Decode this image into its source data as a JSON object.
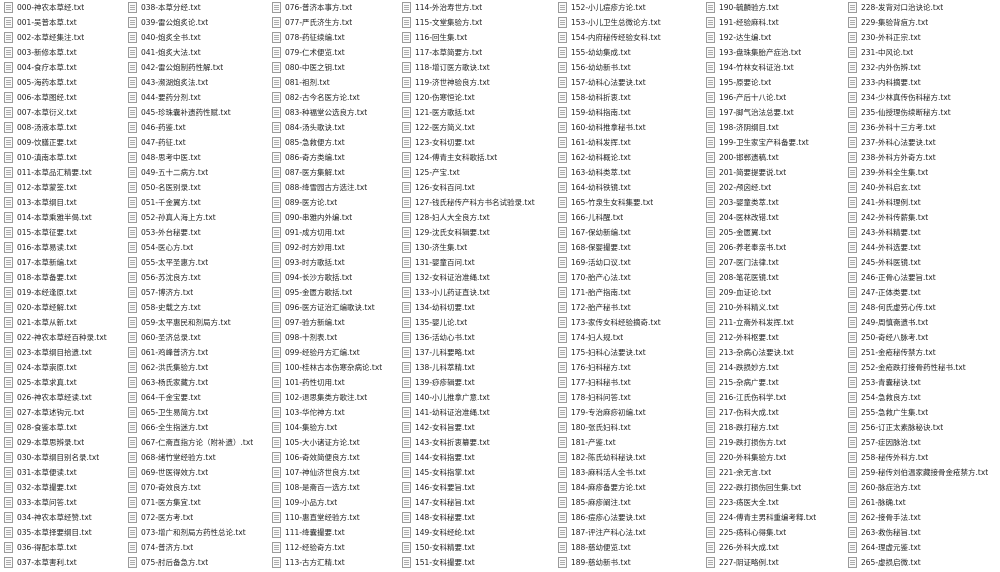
{
  "files": [
    "000-神农本草经.txt",
    "001-吴普本草.txt",
    "002-本草经集注.txt",
    "003-新修本草.txt",
    "004-食疗本草.txt",
    "005-海药本草.txt",
    "006-本草图经.txt",
    "007-本草衍义.txt",
    "008-汤液本草.txt",
    "009-饮膳正要.txt",
    "010-滇南本草.txt",
    "011-本草品汇精要.txt",
    "012-本草蒙筌.txt",
    "013-本草纲目.txt",
    "014-本草乘雅半偈.txt",
    "015-本草征要.txt",
    "016-本草易读.txt",
    "017-本草新编.txt",
    "018-本草备要.txt",
    "019-本经逢原.txt",
    "020-本草经解.txt",
    "021-本草从新.txt",
    "022-神农本草经百种录.txt",
    "023-本草纲目拾遗.txt",
    "024-本草崇原.txt",
    "025-本草求真.txt",
    "026-神农本草经读.txt",
    "027-本草述钩元.txt",
    "028-食鉴本草.txt",
    "029-本草思辨录.txt",
    "030-本草纲目别名录.txt",
    "031-本草便读.txt",
    "032-本草撮要.txt",
    "033-本草问答.txt",
    "034-神农本草经赞.txt",
    "035-本草择要纲目.txt",
    "036-得配本草.txt",
    "037-本草害利.txt",
    "038-本草分经.txt",
    "039-雷公炮炙论.txt",
    "040-炮炙全书.txt",
    "041-炮炙大法.txt",
    "042-雷公炮制药性解.txt",
    "043-濒湖炮炙法.txt",
    "044-要药分剂.txt",
    "045-珍珠囊补遗药性赋.txt",
    "046-药鉴.txt",
    "047-药征.txt",
    "048-思考中医.txt",
    "049-五十二病方.txt",
    "050-名医别录.txt",
    "051-千金翼方.txt",
    "052-孙真人海上方.txt",
    "053-外台秘要.txt",
    "054-医心方.txt",
    "055-太平圣惠方.txt",
    "056-苏沈良方.txt",
    "057-博济方.txt",
    "058-史载之方.txt",
    "059-太平惠民和剂局方.txt",
    "060-圣济总录.txt",
    "061-鸡峰普济方.txt",
    "062-洪氏集验方.txt",
    "063-杨氏家藏方.txt",
    "064-千金宝要.txt",
    "065-卫生易简方.txt",
    "066-全生指迷方.txt",
    "067-仁斋直指方论（附补遗）.txt",
    "068-绪竹堂经验方.txt",
    "069-世医得效方.txt",
    "070-奇效良方.txt",
    "071-医方集宜.txt",
    "072-医方考.txt",
    "073-增广和剂局方药性总论.txt",
    "074-普济方.txt",
    "075-肘后备急方.txt",
    "076-普济本事方.txt",
    "077-严氏济生方.txt",
    "078-药征续编.txt",
    "079-仁术便览.txt",
    "080-中医之钥.txt",
    "081-祖剂.txt",
    "082-古今名医方论.txt",
    "083-种福堂公选良方.txt",
    "084-汤头歌诀.txt",
    "085-急救便方.txt",
    "086-奇方类编.txt",
    "087-医方集解.txt",
    "088-绛雪园古方选注.txt",
    "089-医方论.txt",
    "090-串雅内外编.txt",
    "091-成方切用.txt",
    "092-时方妙用.txt",
    "093-时方歌括.txt",
    "094-长沙方歌括.txt",
    "095-金匮方歌括.txt",
    "096-医方证治汇编歌诀.txt",
    "097-验方新编.txt",
    "098-十剂表.txt",
    "099-经验丹方汇编.txt",
    "100-桂林古本伤寒杂病论.txt",
    "101-药性切用.txt",
    "102-退思集类方歌注.txt",
    "103-华佗神方.txt",
    "104-集验方.txt",
    "105-大小诸证方论.txt",
    "106-奇效简便良方.txt",
    "107-神仙济世良方.txt",
    "108-是斋百一选方.txt",
    "109-小品方.txt",
    "110-惠直堂经验方.txt",
    "111-绛囊撮要.txt",
    "112-经验奇方.txt",
    "113-古方汇精.txt",
    "114-外治寿世方.txt",
    "115-文堂集验方.txt",
    "116-回生集.txt",
    "117-本草简要方.txt",
    "118-增订医方歌诀.txt",
    "119-济世神验良方.txt",
    "120-伤寒恒论.txt",
    "121-医方歌括.txt",
    "122-医方简义.txt",
    "123-女科切要.txt",
    "124-傅青主女科歌括.txt",
    "125-产宝.txt",
    "126-女科百问.txt",
    "127-钱氏秘传产科方书名试验录.txt",
    "128-妇人大全良方.txt",
    "129-沈氏女科辑要.txt",
    "130-济生集.txt",
    "131-婴童百问.txt",
    "132-女科证治准绳.txt",
    "133-小儿药证直诀.txt",
    "134-幼科切要.txt",
    "135-婴儿论.txt",
    "136-活幼心书.txt",
    "137-儿科要略.txt",
    "138-儿科萃精.txt",
    "139-痧疹辑要.txt",
    "140-小儿推拿广意.txt",
    "141-幼科证治准绳.txt",
    "142-女科旨要.txt",
    "143-女科折衷纂要.txt",
    "144-女科指要.txt",
    "145-女科指掌.txt",
    "146-女科要旨.txt",
    "147-女科秘旨.txt",
    "148-女科秘要.txt",
    "149-女科经纶.txt",
    "150-女科精要.txt",
    "151-女科撮要.txt",
    "152-小儿痘疹方论.txt",
    "153-小儿卫生总微论方.txt",
    "154-内府秘传经验女科.txt",
    "155-幼幼集成.txt",
    "156-幼幼新书.txt",
    "157-幼科心法要诀.txt",
    "158-幼科折衷.txt",
    "159-幼科指南.txt",
    "160-幼科推拿秘书.txt",
    "161-幼科发挥.txt",
    "162-幼科概论.txt",
    "163-幼科类萃.txt",
    "164-幼科铁镜.txt",
    "165-竹泉生女科集要.txt",
    "166-儿科醒.txt",
    "167-保幼新编.txt",
    "168-保婴撮要.txt",
    "169-活幼口议.txt",
    "170-胎产心法.txt",
    "171-胎产指南.txt",
    "172-胎产秘书.txt",
    "173-家传女科经验摘奇.txt",
    "174-妇人规.txt",
    "175-妇科心法要诀.txt",
    "176-妇科秘方.txt",
    "177-妇科秘书.txt",
    "178-妇科问答.txt",
    "179-专治麻痧初编.txt",
    "180-张氏妇科.txt",
    "181-产鉴.txt",
    "182-陈氏幼科秘诀.txt",
    "183-麻科活人全书.txt",
    "184-麻疹备要方论.txt",
    "185-麻疹阐注.txt",
    "186-痘疹心法要诀.txt",
    "187-评注产科心法.txt",
    "188-慈幼便览.txt",
    "189-慈幼新书.txt",
    "190-毓麟验方.txt",
    "191-经验麻科.txt",
    "192-达生编.txt",
    "193-盘珠集胎产症治.txt",
    "194-竹林女科证治.txt",
    "195-原要论.txt",
    "196-产后十八论.txt",
    "197-脚气治法总要.txt",
    "198-济阴纲目.txt",
    "199-卫生家宝产科备要.txt",
    "200-邯郸遗稿.txt",
    "201-简要提要说.txt",
    "202-颅囟经.txt",
    "203-婴童类萃.txt",
    "204-医林改错.txt",
    "205-金匮翼.txt",
    "206-养老奉亲书.txt",
    "207-医门法律.txt",
    "208-笔花医镜.txt",
    "209-血证论.txt",
    "210-外科精义.txt",
    "211-立斋外科发挥.txt",
    "212-外科枢要.txt",
    "213-杂病心法要诀.txt",
    "214-跌损妙方.txt",
    "215-杂病广要.txt",
    "216-江氏伤科学.txt",
    "217-伤科大成.txt",
    "218-跌打秘方.txt",
    "219-跌打损伤方.txt",
    "220-外科集验方.txt",
    "221-余无言.txt",
    "222-跌打损伤回生集.txt",
    "223-疡医大全.txt",
    "224-傅青主男科重编考释.txt",
    "225-疡科心得集.txt",
    "226-外科大成.txt",
    "227-阴证略例.txt",
    "228-发背对口治诀论.txt",
    "229-集验背疽方.txt",
    "230-外科正宗.txt",
    "231-中风论.txt",
    "232-内外伤辨.txt",
    "233-内科摘要.txt",
    "234-少林真传伤科秘方.txt",
    "235-仙授理伤续断秘方.txt",
    "236-外科十三方考.txt",
    "237-外科心法要诀.txt",
    "238-外科方外奇方.txt",
    "239-外科全生集.txt",
    "240-外科启玄.txt",
    "241-外科理例.txt",
    "242-外科传薪集.txt",
    "243-外科精要.txt",
    "244-外科选要.txt",
    "245-外科医镜.txt",
    "246-正骨心法要旨.txt",
    "247-正体类要.txt",
    "248-何氏虚劳心传.txt",
    "249-周慎斋遗书.txt",
    "250-奇经八脉考.txt",
    "251-金疮秘传禁方.txt",
    "252-金疮跌打接骨药性秘书.txt",
    "253-青囊秘诀.txt",
    "254-急救良方.txt",
    "255-急救广生集.txt",
    "256-订正太素脉秘诀.txt",
    "257-症因脉治.txt",
    "258-秘传外科方.txt",
    "259-秘传刘伯温家藏接骨金疮禁方.txt",
    "260-脉症治方.txt",
    "261-脉确.txt",
    "262-接骨手法.txt",
    "263-救伤秘旨.txt",
    "264-理虚元鉴.txt",
    "265-虚损启微.txt"
  ]
}
